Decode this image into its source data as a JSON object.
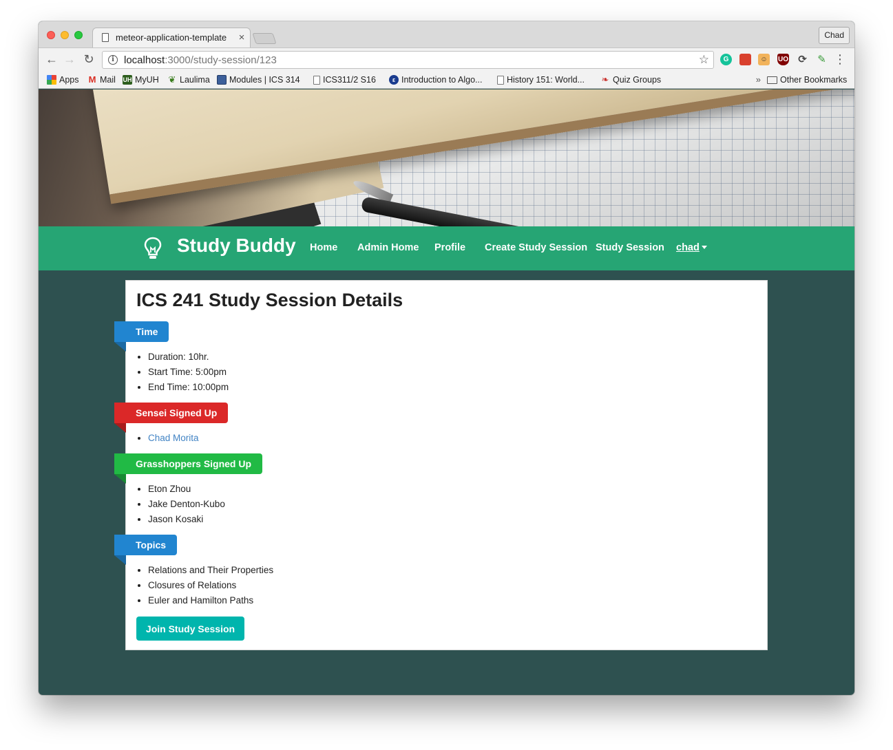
{
  "browser": {
    "tab_title": "meteor-application-template",
    "tab_close": "×",
    "profile_name": "Chad",
    "url_host": "localhost",
    "url_path": ":3000/study-session/123",
    "bookmarks": [
      {
        "label": "Apps",
        "icon": "apps-grid-icon"
      },
      {
        "label": "Mail",
        "icon": "gmail-icon"
      },
      {
        "label": "MyUH",
        "icon": "myuh-icon"
      },
      {
        "label": "Laulima",
        "icon": "laulima-leaf-icon"
      },
      {
        "label": "Modules | ICS 314",
        "icon": "modules-icon"
      },
      {
        "label": "ICS311/2 S16",
        "icon": "page-icon"
      },
      {
        "label": "Introduction to Algo...",
        "icon": "algo-icon"
      },
      {
        "label": "History 151: World...",
        "icon": "page-icon"
      },
      {
        "label": "Quiz Groups",
        "icon": "quiz-icon"
      }
    ],
    "other_bookmarks": "Other Bookmarks",
    "overflow_chevron": "»"
  },
  "app": {
    "brand": "Study Buddy",
    "nav": {
      "home": "Home",
      "admin_home": "Admin Home",
      "profile": "Profile",
      "create_session": "Create Study Session",
      "study_session": "Study Session",
      "user": "chad"
    }
  },
  "session": {
    "title": "ICS 241 Study Session Details",
    "time_label": "Time",
    "time_items": [
      "Duration: 10hr.",
      "Start Time: 5:00pm",
      "End Time: 10:00pm"
    ],
    "sensei_label": "Sensei Signed Up",
    "sensei": [
      "Chad Morita"
    ],
    "grasshoppers_label": "Grasshoppers Signed Up",
    "grasshoppers": [
      "Eton Zhou",
      "Jake Denton-Kubo",
      "Jason Kosaki"
    ],
    "topics_label": "Topics",
    "topics": [
      "Relations and Their Properties",
      "Closures of Relations",
      "Euler and Hamilton Paths"
    ],
    "join_button": "Join Study Session"
  },
  "colors": {
    "navbar": "#26a574",
    "background": "#2e5150",
    "ribbon_blue": "#2185d0",
    "ribbon_red": "#db2828",
    "ribbon_green": "#21ba45",
    "join_button": "#00b5ad"
  }
}
